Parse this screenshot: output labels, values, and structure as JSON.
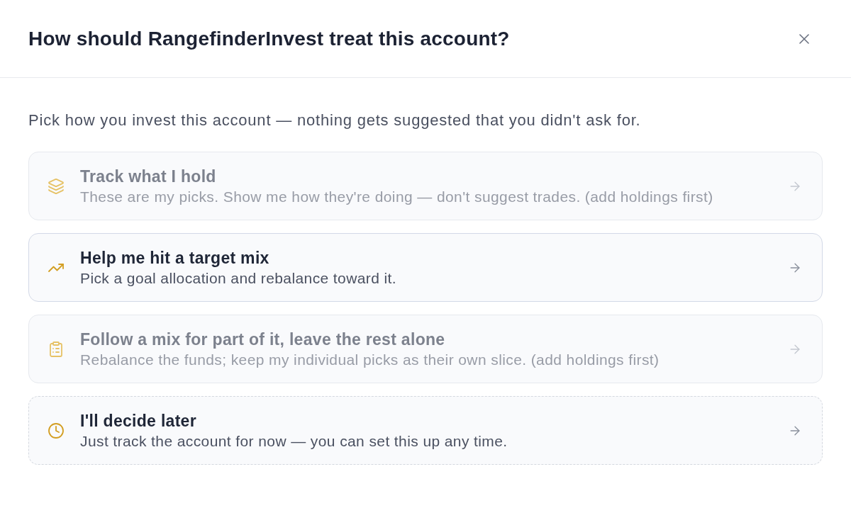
{
  "dialog": {
    "title": "How should RangefinderInvest treat this account?",
    "intro": "Pick how you invest this account — nothing gets suggested that you didn't ask for.",
    "options": [
      {
        "kind": "option",
        "title": "Track what I hold",
        "description": "These are my picks. Show me how they're doing — don't suggest trades. (add holdings first)",
        "disabled": true
      },
      {
        "kind": "option",
        "title": "Help me hit a target mix",
        "description": "Pick a goal allocation and rebalance toward it.",
        "disabled": false
      },
      {
        "kind": "option",
        "title": "Follow a mix for part of it, leave the rest alone",
        "description": "Rebalance the funds; keep my individual picks as their own slice. (add holdings first)",
        "disabled": true
      },
      {
        "kind": "later",
        "title": "I'll decide later",
        "description": "Just track the account for now — you can set this up any time.",
        "disabled": false
      }
    ]
  }
}
